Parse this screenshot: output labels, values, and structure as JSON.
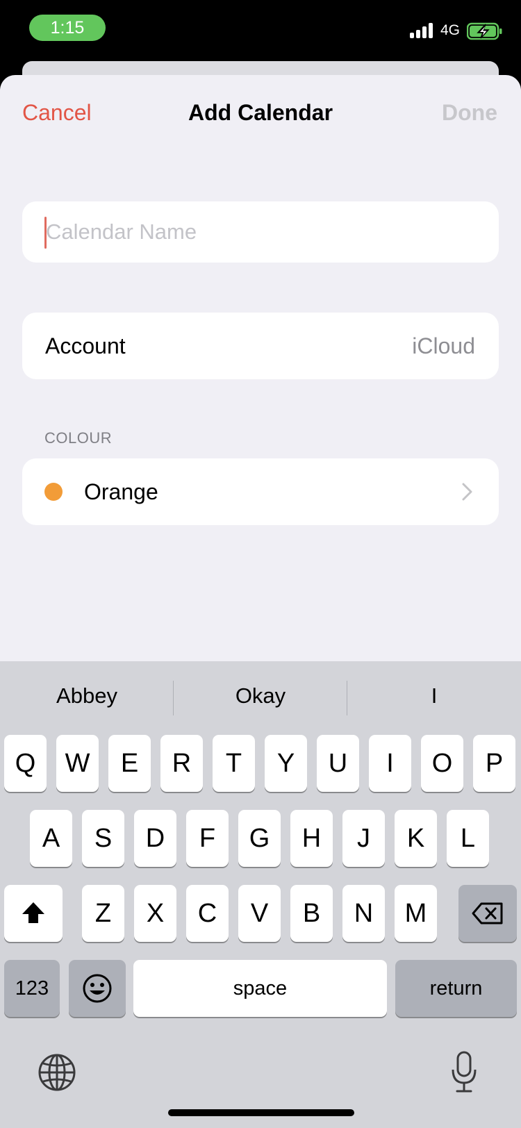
{
  "status": {
    "time": "1:15",
    "network": "4G"
  },
  "nav": {
    "cancel": "Cancel",
    "title": "Add Calendar",
    "done": "Done"
  },
  "name_field": {
    "placeholder": "Calendar Name",
    "value": ""
  },
  "account": {
    "label": "Account",
    "value": "iCloud"
  },
  "colour_section": {
    "header": "COLOUR",
    "label": "Orange",
    "color": "#f29c38"
  },
  "colors": {
    "accent": "#e25546",
    "disabled": "#c7c7cb"
  },
  "keyboard": {
    "suggestions": [
      "Abbey",
      "Okay",
      "I"
    ],
    "row1": [
      "Q",
      "W",
      "E",
      "R",
      "T",
      "Y",
      "U",
      "I",
      "O",
      "P"
    ],
    "row2": [
      "A",
      "S",
      "D",
      "F",
      "G",
      "H",
      "J",
      "K",
      "L"
    ],
    "row3": [
      "Z",
      "X",
      "C",
      "V",
      "B",
      "N",
      "M"
    ],
    "numbers_label": "123",
    "space_label": "space",
    "return_label": "return"
  }
}
